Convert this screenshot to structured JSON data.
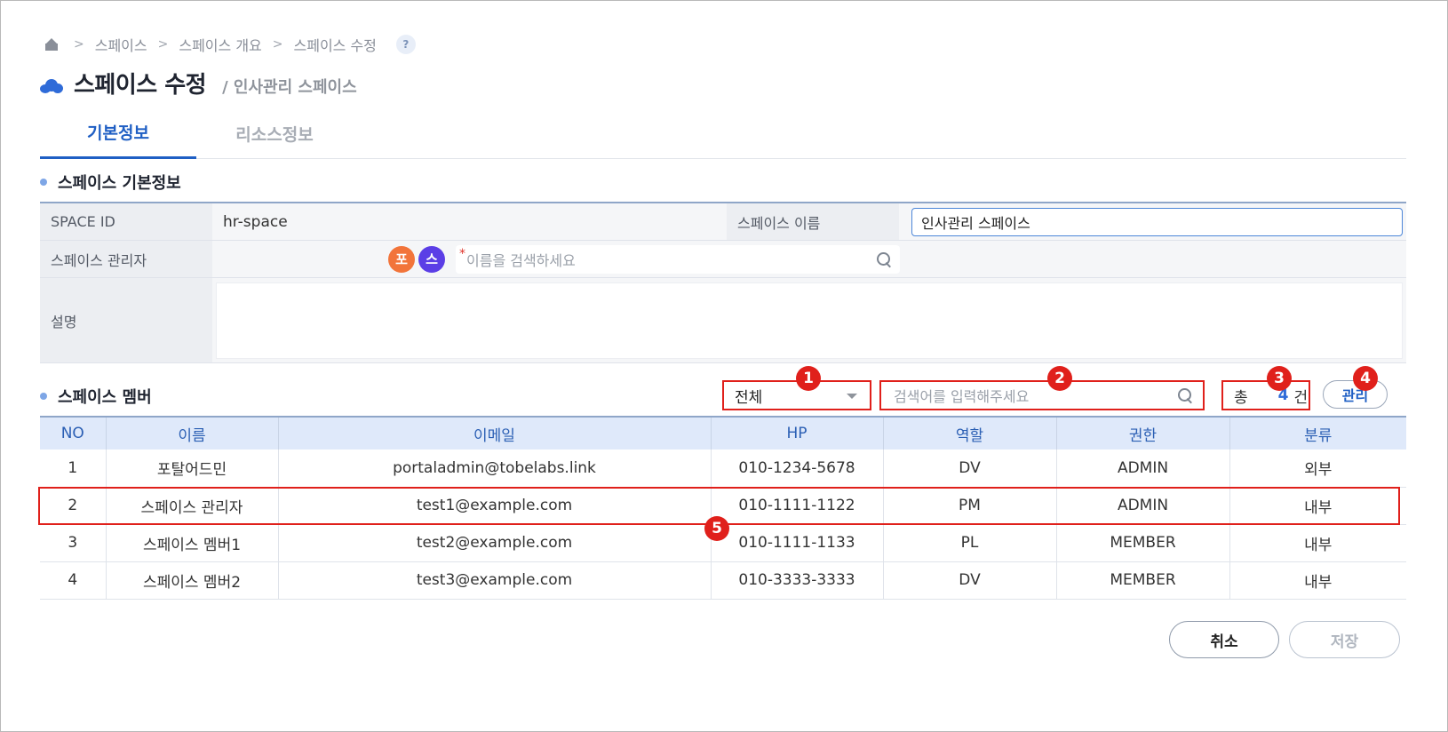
{
  "breadcrumb": {
    "items": [
      "스페이스",
      "스페이스 개요",
      "스페이스 수정"
    ],
    "help": "?"
  },
  "header": {
    "title": "스페이스 수정",
    "subtitle": "/ 인사관리 스페이스"
  },
  "tabs": [
    {
      "label": "기본정보",
      "active": true
    },
    {
      "label": "리소스정보",
      "active": false
    }
  ],
  "basic_info": {
    "section_title": "스페이스 기본정보",
    "space_id_label": "SPACE ID",
    "space_id_value": "hr-space",
    "space_name_label": "스페이스 이름",
    "space_name_value": "인사관리 스페이스",
    "manager_label": "스페이스 관리자",
    "manager_avatars": [
      {
        "text": "포",
        "color": "#f2743a"
      },
      {
        "text": "스",
        "color": "#5b3ee6"
      }
    ],
    "manager_required_mark": "*",
    "manager_search_placeholder": "이름을 검색하세요",
    "description_label": "설명",
    "description_value": ""
  },
  "members": {
    "section_title": "스페이스 멤버",
    "filter_value": "전체",
    "search_placeholder": "검색어를 입력해주세요",
    "total_prefix": "총",
    "total_count": "4",
    "total_suffix": "건",
    "manage_label": "관리",
    "columns": [
      "NO",
      "이름",
      "이메일",
      "HP",
      "역할",
      "권한",
      "분류"
    ],
    "rows": [
      [
        "1",
        "포탈어드민",
        "portaladmin@tobelabs.link",
        "010-1234-5678",
        "DV",
        "ADMIN",
        "외부"
      ],
      [
        "2",
        "스페이스 관리자",
        "test1@example.com",
        "010-1111-1122",
        "PM",
        "ADMIN",
        "내부"
      ],
      [
        "3",
        "스페이스 멤버1",
        "test2@example.com",
        "010-1111-1133",
        "PL",
        "MEMBER",
        "내부"
      ],
      [
        "4",
        "스페이스 멤버2",
        "test3@example.com",
        "010-3333-3333",
        "DV",
        "MEMBER",
        "내부"
      ]
    ]
  },
  "markers": [
    "1",
    "2",
    "3",
    "4",
    "5"
  ],
  "actions": {
    "cancel_label": "취소",
    "save_label": "저장"
  },
  "colors": {
    "accent": "#1f5fc4",
    "highlight": "#e0201b",
    "header_bg": "#dfe9fa"
  }
}
